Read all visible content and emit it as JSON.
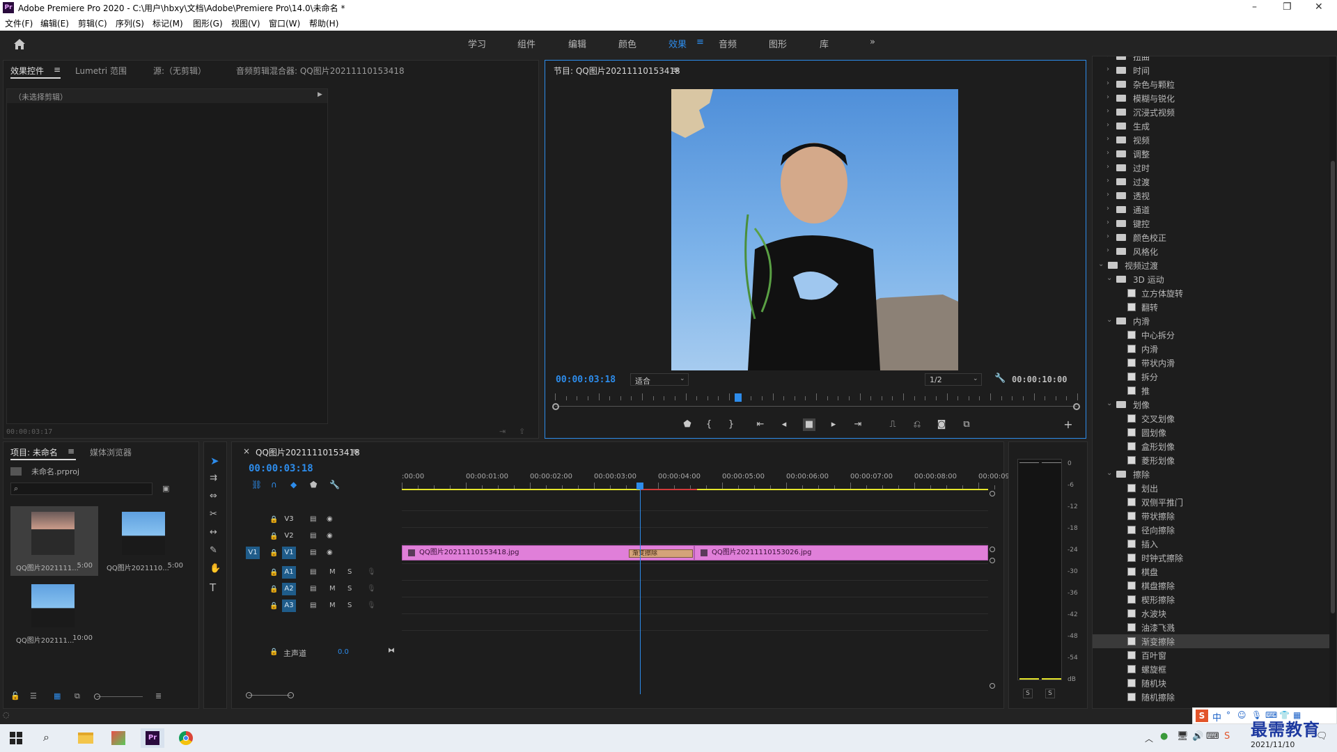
{
  "window": {
    "title": "Adobe Premiere Pro 2020 - C:\\用户\\hbxy\\文档\\Adobe\\Premiere Pro\\14.0\\未命名 *",
    "logo": "Pr",
    "controls": [
      "–",
      "❐",
      "✕"
    ]
  },
  "menu": [
    "文件(F)",
    "编辑(E)",
    "剪辑(C)",
    "序列(S)",
    "标记(M)",
    "图形(G)",
    "视图(V)",
    "窗口(W)",
    "帮助(H)"
  ],
  "workspaces": {
    "tabs": [
      "学习",
      "组件",
      "编辑",
      "颜色",
      "效果",
      "音频",
      "图形",
      "库"
    ],
    "active": "效果",
    "more": "»"
  },
  "source_panel": {
    "tabs": [
      "效果控件",
      "Lumetri 范围",
      "源:（无剪辑）",
      "音频剪辑混合器: QQ图片20211110153418"
    ],
    "no_clip": "（未选择剪辑）",
    "timecode": "00:00:03:17"
  },
  "program_monitor": {
    "title": "节目: QQ图片20211110153418",
    "timecode": "00:00:03:18",
    "fit": "适合",
    "resolution": "1/2",
    "duration": "00:00:10:00",
    "playhead_fraction": 0.35
  },
  "project_panel": {
    "tabs": [
      "项目: 未命名",
      "媒体浏览器"
    ],
    "project_file": "未命名.prproj",
    "items": [
      {
        "name": "QQ图片2021111...",
        "duration": "5:00"
      },
      {
        "name": "QQ图片2021110...",
        "duration": "5:00"
      },
      {
        "name": "QQ图片202111...",
        "duration": "10:00"
      }
    ]
  },
  "timeline": {
    "sequence": "QQ图片20211110153418",
    "timecode": "00:00:03:18",
    "ruler": [
      ":00:00",
      "00:00:01:00",
      "00:00:02:00",
      "00:00:03:00",
      "00:00:04:00",
      "00:00:05:00",
      "00:00:06:00",
      "00:00:07:00",
      "00:00:08:00",
      "00:00:09:"
    ],
    "video_tracks": [
      "V3",
      "V2",
      "V1"
    ],
    "source_patch": "V1",
    "audio_tracks": [
      "A1",
      "A2",
      "A3"
    ],
    "master_label": "主声道",
    "master_value": "0.0",
    "track_buttons": {
      "mute": "M",
      "solo": "S"
    },
    "clips": [
      {
        "name": "QQ图片20211110153418.jpg"
      },
      {
        "name": "QQ图片20211110153026.jpg"
      }
    ],
    "transition": "渐变擦除"
  },
  "effects_tree": [
    {
      "level": 1,
      "kind": "folder",
      "label": "扭曲",
      "open": false
    },
    {
      "level": 1,
      "kind": "folder",
      "label": "时间",
      "open": false
    },
    {
      "level": 1,
      "kind": "folder",
      "label": "杂色与颗粒",
      "open": false
    },
    {
      "level": 1,
      "kind": "folder",
      "label": "模糊与锐化",
      "open": false
    },
    {
      "level": 1,
      "kind": "folder",
      "label": "沉浸式视频",
      "open": false
    },
    {
      "level": 1,
      "kind": "folder",
      "label": "生成",
      "open": false
    },
    {
      "level": 1,
      "kind": "folder",
      "label": "视频",
      "open": false
    },
    {
      "level": 1,
      "kind": "folder",
      "label": "调整",
      "open": false
    },
    {
      "level": 1,
      "kind": "folder",
      "label": "过时",
      "open": false
    },
    {
      "level": 1,
      "kind": "folder",
      "label": "过渡",
      "open": false
    },
    {
      "level": 1,
      "kind": "folder",
      "label": "透视",
      "open": false
    },
    {
      "level": 1,
      "kind": "folder",
      "label": "通道",
      "open": false
    },
    {
      "level": 1,
      "kind": "folder",
      "label": "键控",
      "open": false
    },
    {
      "level": 1,
      "kind": "folder",
      "label": "颜色校正",
      "open": false
    },
    {
      "level": 1,
      "kind": "folder",
      "label": "风格化",
      "open": false
    },
    {
      "level": 0,
      "kind": "folder",
      "label": "视频过渡",
      "open": true
    },
    {
      "level": 1,
      "kind": "folder",
      "label": "3D 运动",
      "open": true
    },
    {
      "level": 2,
      "kind": "fx",
      "label": "立方体旋转"
    },
    {
      "level": 2,
      "kind": "fx",
      "label": "翻转"
    },
    {
      "level": 1,
      "kind": "folder",
      "label": "内滑",
      "open": true
    },
    {
      "level": 2,
      "kind": "fx",
      "label": "中心拆分"
    },
    {
      "level": 2,
      "kind": "fx",
      "label": "内滑"
    },
    {
      "level": 2,
      "kind": "fx",
      "label": "带状内滑"
    },
    {
      "level": 2,
      "kind": "fx",
      "label": "拆分"
    },
    {
      "level": 2,
      "kind": "fx",
      "label": "推"
    },
    {
      "level": 1,
      "kind": "folder",
      "label": "划像",
      "open": true
    },
    {
      "level": 2,
      "kind": "fx",
      "label": "交叉划像"
    },
    {
      "level": 2,
      "kind": "fx",
      "label": "圆划像"
    },
    {
      "level": 2,
      "kind": "fx",
      "label": "盒形划像"
    },
    {
      "level": 2,
      "kind": "fx",
      "label": "菱形划像"
    },
    {
      "level": 1,
      "kind": "folder",
      "label": "擦除",
      "open": true
    },
    {
      "level": 2,
      "kind": "fx",
      "label": "划出"
    },
    {
      "level": 2,
      "kind": "fx",
      "label": "双侧平推门"
    },
    {
      "level": 2,
      "kind": "fx",
      "label": "带状擦除"
    },
    {
      "level": 2,
      "kind": "fx",
      "label": "径向擦除"
    },
    {
      "level": 2,
      "kind": "fx",
      "label": "插入"
    },
    {
      "level": 2,
      "kind": "fx",
      "label": "时钟式擦除"
    },
    {
      "level": 2,
      "kind": "fx",
      "label": "棋盘"
    },
    {
      "level": 2,
      "kind": "fx",
      "label": "棋盘擦除"
    },
    {
      "level": 2,
      "kind": "fx",
      "label": "楔形擦除"
    },
    {
      "level": 2,
      "kind": "fx",
      "label": "水波块"
    },
    {
      "level": 2,
      "kind": "fx",
      "label": "油漆飞溅"
    },
    {
      "level": 2,
      "kind": "fx",
      "label": "渐变擦除",
      "selected": true
    },
    {
      "level": 2,
      "kind": "fx",
      "label": "百叶窗"
    },
    {
      "level": 2,
      "kind": "fx",
      "label": "螺旋框"
    },
    {
      "level": 2,
      "kind": "fx",
      "label": "随机块"
    },
    {
      "level": 2,
      "kind": "fx",
      "label": "随机擦除"
    }
  ],
  "audio_meter": {
    "scale": [
      "0",
      "-6",
      "-12",
      "-18",
      "-24",
      "-30",
      "-36",
      "-42",
      "-48",
      "-54",
      "dB"
    ],
    "solo": [
      "S",
      "S"
    ]
  },
  "taskbar": {
    "time": "",
    "date": "2021/11/10",
    "watermark": "最需教育",
    "ime": "中"
  },
  "colors": {
    "accent": "#2d8ceb",
    "clip": "#e07fd9",
    "transition": "#d4a37a",
    "work_area": "#e5e52b"
  }
}
